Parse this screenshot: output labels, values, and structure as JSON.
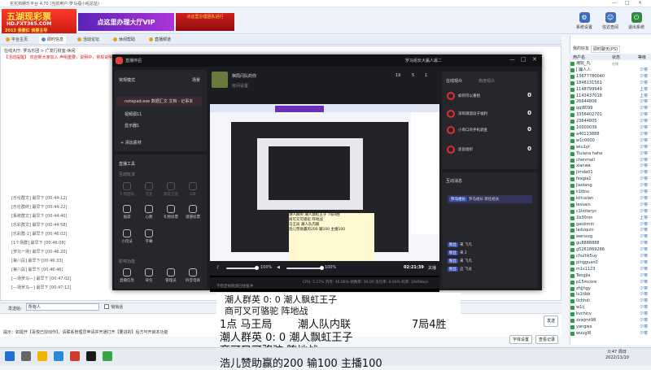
{
  "app": {
    "title": "花花狗娱乐平台 4.70 (当前用户:罗马福小组总监)",
    "window_controls": [
      "—",
      "□",
      "✕"
    ]
  },
  "header": {
    "logo_main": "五湖现彩票",
    "logo_url": "HD.FXT365.COM",
    "logo_slogan": "2013 我要红 我要主导",
    "banner_vip": "点这里办理大厅VIP",
    "banner_side": "点这里办理团队进行",
    "buttons": [
      {
        "label": "系统设置",
        "icon": "gear-icon"
      },
      {
        "label": "信访查阅",
        "icon": "person-icon"
      },
      {
        "label": "退出系统",
        "icon": "exit-icon"
      }
    ]
  },
  "tabs": [
    {
      "label": "平台主页"
    },
    {
      "label": "即时信息"
    },
    {
      "label": "活动论坛"
    },
    {
      "label": "休闲帮助"
    },
    {
      "label": "直播频道"
    }
  ],
  "chat": {
    "address": "在线大厅: 罗马乐团 > 广发行财室-休闲",
    "notice": "【活动提醒】 欢迎新大家加入 声明重要，说明中，常规说明，日常维护公告 …",
    "messages": [
      "[乐伦群文] 最早下 [00:44:12]",
      "[乐伦群终] 最早下 [00:44:22]",
      "[系统群文] 最早下 [00:44:40]",
      "[乐彩群文] 最早下 [00:44:58]",
      "[乐彩群-1] 最早下 [00:46:02]",
      "[1个场群] 最早下 [00:46:08]",
      "[罗马一场] 最早下 [00:46:20]",
      "[第八段] 最早下 [00:46:33]",
      "[第八段] 最早下 [00:46:46]",
      "[—场罗马—] 最早下 [00:47:02]",
      "[—场罗马—] 最早下 [00:47:12]"
    ]
  },
  "input": {
    "label": "发送给:",
    "value": "所有人",
    "checkbox_label": "悄悄话",
    "send_label": "发送",
    "clear_label": "清屏",
    "settings_label": "字体设置",
    "history_label": "查看记录",
    "hint": "提示：如需开【喜悦已授动作】，请联系管理员申请并开通打开【要进的】后方可开启本功能"
  },
  "right_panel": {
    "tabs": [
      "我的好友",
      "即时聊天(PS)"
    ],
    "columns": [
      "用户名",
      "状态",
      "等级"
    ],
    "users": [
      {
        "name": "潮玩_丸",
        "status": "在线",
        "rank": ""
      },
      {
        "name": "J 蹦人人",
        "status": "",
        "rank": "少将"
      },
      {
        "name": "13677780040",
        "status": "",
        "rank": "少将"
      },
      {
        "name": "1848131561",
        "status": "",
        "rank": "少将"
      },
      {
        "name": "1148799949",
        "status": "",
        "rank": "上将"
      },
      {
        "name": "1143437018",
        "status": "",
        "rank": "上将"
      },
      {
        "name": "26644806",
        "status": "",
        "rank": "少将"
      },
      {
        "name": "qqi8099",
        "status": "",
        "rank": "少将"
      },
      {
        "name": "3356402701",
        "status": "",
        "rank": "少将"
      },
      {
        "name": "23644805",
        "status": "",
        "rank": "少将"
      },
      {
        "name": "10000039",
        "status": "",
        "rank": "少将"
      },
      {
        "name": "a40123888",
        "status": "",
        "rank": "少将"
      },
      {
        "name": "w1c0000",
        "status": "",
        "rank": "少将"
      },
      {
        "name": "wiu1yr",
        "status": "",
        "rank": "少将"
      },
      {
        "name": "Tiuiana haha",
        "status": "",
        "rank": "少将"
      },
      {
        "name": "chenmail",
        "status": "",
        "rank": "少将"
      },
      {
        "name": "xianwa",
        "status": "",
        "rank": "少将"
      },
      {
        "name": "jirnde01",
        "status": "",
        "rank": "少将"
      },
      {
        "name": "fexgia1",
        "status": "",
        "rank": "少将"
      },
      {
        "name": "jiaolang",
        "status": "",
        "rank": "少将"
      },
      {
        "name": "k1tbsc",
        "status": "",
        "rank": "少将"
      },
      {
        "name": "kilruslan",
        "status": "",
        "rank": "少将"
      },
      {
        "name": "lesvain",
        "status": "",
        "rank": "少将"
      },
      {
        "name": "c1lotteryc",
        "status": "",
        "rank": "少将"
      },
      {
        "name": "1b30nin",
        "status": "",
        "rank": "上将"
      },
      {
        "name": "ganbmin",
        "status": "",
        "rank": "少将"
      },
      {
        "name": "laduquin",
        "status": "",
        "rank": "少将"
      },
      {
        "name": "wersszg",
        "status": "",
        "rank": "少将"
      },
      {
        "name": "gu8888888",
        "status": "",
        "rank": "少将"
      },
      {
        "name": "g5261869266",
        "status": "",
        "rank": "少将"
      },
      {
        "name": "chuihk5uy",
        "status": "",
        "rank": "少将"
      },
      {
        "name": "pingguan0",
        "status": "",
        "rank": "少将"
      },
      {
        "name": "m1s1123",
        "status": "",
        "rank": "少将"
      },
      {
        "name": "Tengjia",
        "status": "",
        "rank": "少将"
      },
      {
        "name": "p15mcore",
        "status": "",
        "rank": "少将"
      },
      {
        "name": "zhjjhgy",
        "status": "",
        "rank": "少将"
      },
      {
        "name": "lu1tibb",
        "status": "",
        "rank": "少将"
      },
      {
        "name": "0chhdi",
        "status": "",
        "rank": "少将"
      },
      {
        "name": "w1ij",
        "status": "",
        "rank": "少将"
      },
      {
        "name": "kvchicv",
        "status": "",
        "rank": "少将"
      },
      {
        "name": "zxwjmt98",
        "status": "",
        "rank": "少将"
      },
      {
        "name": "yangwo",
        "status": "",
        "rank": "少将"
      },
      {
        "name": "wuugl8",
        "status": "",
        "rank": "少将"
      }
    ]
  },
  "streamer": {
    "app_name": "直播伴侣",
    "mode": "常规模式",
    "scene_label": "场景",
    "user": "罗马组长大赢人最二",
    "sources": [
      {
        "label": "notepad.exe 数据汇文 文档 - 记事本",
        "selected": true
      },
      {
        "label": "视频源11",
        "selected": false
      },
      {
        "label": "显示器1",
        "selected": false
      }
    ],
    "add_material": "+ 添加素材",
    "live_tools_title": "直播工具",
    "interactive_title": "互动玩法",
    "tools_row1": [
      "礼物面板",
      "连麦",
      "蘑菇王座",
      "K歌"
    ],
    "tools_row2": [
      "福袋",
      "心愿",
      "礼物投票",
      "道德投票"
    ],
    "tools_row3": [
      "小玩法",
      "字幕"
    ],
    "more_title": "影响功能",
    "tools_row4": [
      "直播信息",
      "背包",
      "管理员",
      "抖音电商"
    ],
    "room_title": "棋局闪队的你",
    "room_sub": "房间设置",
    "stats": [
      "19",
      "5",
      "1"
    ],
    "volume_mic": "100%",
    "volume_sys": "100%",
    "timer": "02:21:39",
    "live_label": "关播",
    "status": "CPU: 5.27%  内存: 46.06%  帧数率: 30.00  丢包率: 0.00%  码率: 2949kb/s",
    "status_hint": "不稳定视频源已经缓冲",
    "online_title": "在线观众",
    "online_tab2": "热度观众",
    "viewers": [
      {
        "name": "如何可以重组",
        "value": "0"
      },
      {
        "name": "深圳潮湿段子福利",
        "value": "0"
      },
      {
        "name": "小哥口的手机调查",
        "value": "0"
      },
      {
        "name": "思良组织",
        "value": "0"
      }
    ],
    "interact_title": "互动消息",
    "messages": [
      {
        "tag": "罗马组长",
        "text": "罗马组长 新任组长"
      },
      {
        "tag": "粉丝",
        "text": "来 飞凡"
      },
      {
        "tag": "粉丝",
        "text": "来 2"
      },
      {
        "tag": "粉丝",
        "text": "来 飞凡"
      },
      {
        "tag": "粉丝",
        "text": "这 飞龙"
      }
    ]
  },
  "document": {
    "line1": "潮人群英 0:  0  潮人飘虹王子",
    "line2": "商可叉可骆驼    阵地战",
    "line3_left": "1点  马王局",
    "line3_mid": "潮人队内联",
    "line3_right": "7局4胜",
    "line4": "潮人群英 0:  0  潮人飘虹王子",
    "line5": "商可叉可骆驼    阵地战",
    "line6": "浩儿赞助赢的200  输100  主播100"
  },
  "preview_doc": {
    "l1": "潮人群英 潮人飘虹王子    7局4胜",
    "l2": "商可叉可骆驼    阵地战",
    "l3": "马王局  潮人队内联",
    "l4": "浩儿赞助赢的200 输100 主播100"
  },
  "taskbar": {
    "time": "0:47 周日",
    "date": "2022/11/10"
  }
}
